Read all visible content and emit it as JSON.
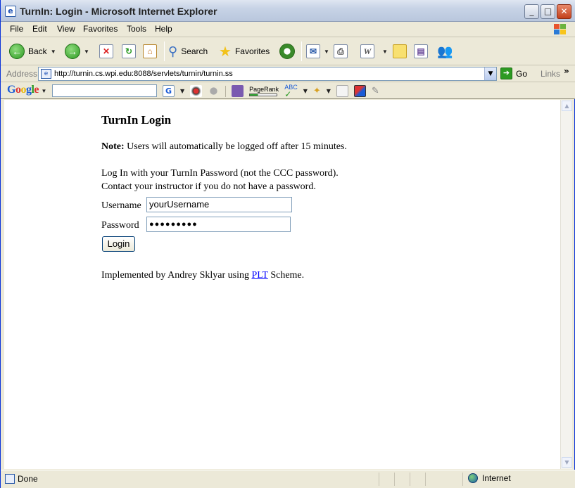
{
  "window": {
    "title": "TurnIn: Login - Microsoft Internet Explorer"
  },
  "menu": [
    "File",
    "Edit",
    "View",
    "Favorites",
    "Tools",
    "Help"
  ],
  "toolbar": {
    "back": "Back",
    "search": "Search",
    "favorites": "Favorites"
  },
  "address": {
    "label": "Address",
    "url": "http://turnin.cs.wpi.edu:8088/servlets/turnin/turnin.ss",
    "go": "Go",
    "links": "Links"
  },
  "google": {
    "logo": "Google",
    "pagerank": "PageRank",
    "abc": "ABC"
  },
  "page": {
    "heading": "TurnIn Login",
    "note_label": "Note:",
    "note_text": " Users will automatically be logged off after 15 minutes.",
    "instruction_1": "Log In with your TurnIn Password (not the CCC password).",
    "instruction_2": "Contact your instructor if you do not have a password.",
    "username_label": "Username",
    "username_value": "yourUsername",
    "password_label": "Password",
    "password_value": "●●●●●●●●●",
    "login_button": "Login",
    "impl_prefix": "Implemented by Andrey Sklyar using ",
    "impl_link": "PLT",
    "impl_suffix": " Scheme."
  },
  "status": {
    "text": "Done",
    "zone": "Internet"
  }
}
